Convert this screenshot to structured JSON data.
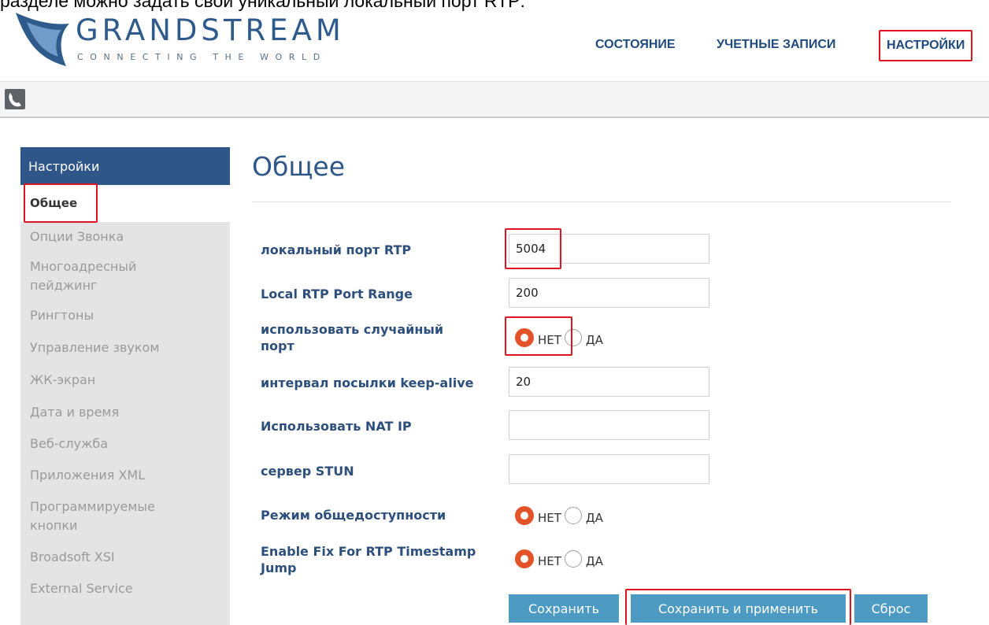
{
  "caption": "разделе можно задать свой уникальный локальный порт RTP:",
  "logo": {
    "name": "GRANDSTREAM",
    "tagline": "CONNECTING THE WORLD"
  },
  "topnav": {
    "status": "СОСТОЯНИЕ",
    "accounts": "УЧЕТНЫЕ ЗАПИСИ",
    "settings": "НАСТРОЙКИ"
  },
  "toolbar": {
    "icon": "phone-handset-icon"
  },
  "sidebar": {
    "header": "Настройки",
    "items": [
      {
        "label": "Общее",
        "active": true
      },
      {
        "label": "Опции Звонка"
      },
      {
        "label": "Многоадресный\nпейджинг"
      },
      {
        "label": "Рингтоны"
      },
      {
        "label": "Управление звуком"
      },
      {
        "label": "ЖК-экран"
      },
      {
        "label": "Дата и время"
      },
      {
        "label": "Веб-служба"
      },
      {
        "label": "Приложения XML"
      },
      {
        "label": "Программируемые\nкнопки"
      },
      {
        "label": "Broadsoft XSI"
      },
      {
        "label": "External Service"
      }
    ]
  },
  "main": {
    "title": "Общее",
    "fields": {
      "rtp_port": {
        "label": "локальный порт RTP",
        "value": "5004"
      },
      "rtp_range": {
        "label": "Local RTP Port Range",
        "value": "200"
      },
      "random_port": {
        "label": "использовать случайный\nпорт",
        "no": "НЕТ",
        "yes": "ДА",
        "selected": "НЕТ"
      },
      "keepalive": {
        "label": "интервал посылки keep-alive",
        "value": "20"
      },
      "nat_ip": {
        "label": "Использовать NAT IP",
        "value": ""
      },
      "stun": {
        "label": "сервер STUN",
        "value": ""
      },
      "public_mode": {
        "label": "Режим общедоступности",
        "no": "НЕТ",
        "yes": "ДА",
        "selected": "НЕТ"
      },
      "rtp_ts_fix": {
        "label": "Enable Fix For RTP Timestamp\nJump",
        "no": "НЕТ",
        "yes": "ДА",
        "selected": "НЕТ"
      }
    },
    "buttons": {
      "save": "Сохранить",
      "save_apply": "Сохранить и применить",
      "reset": "Сброс"
    }
  },
  "colors": {
    "brand": "#2f5688",
    "button": "#4d9ac3",
    "radio": "#e35228",
    "highlight": "#e0141e"
  }
}
